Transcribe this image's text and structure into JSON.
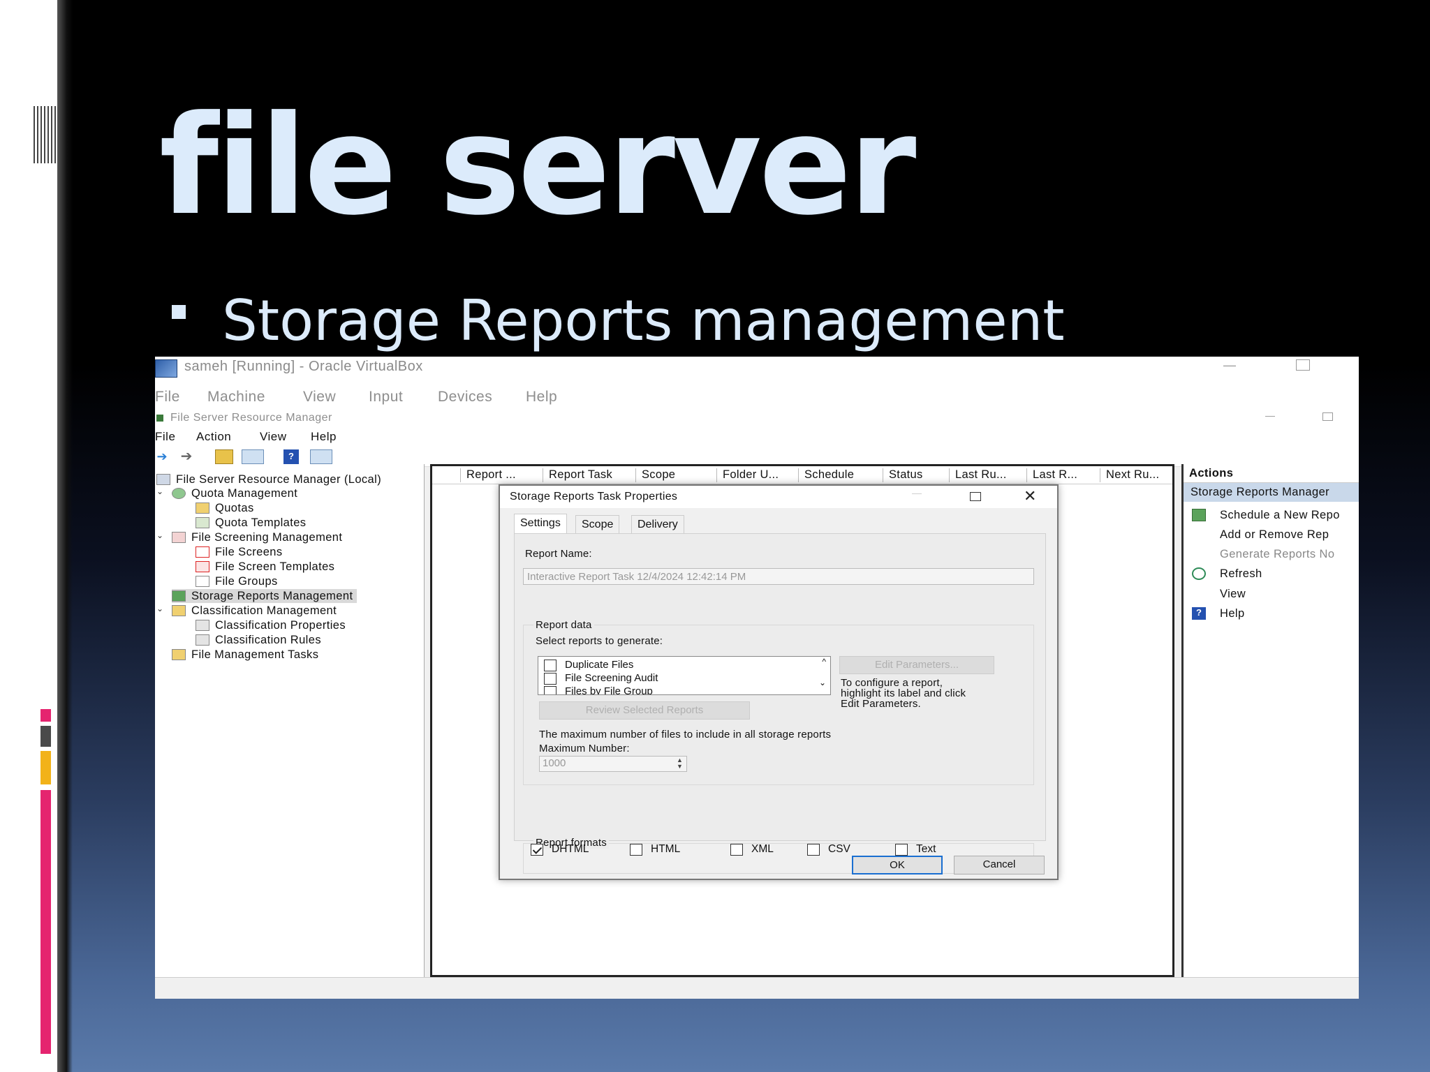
{
  "slide": {
    "title": "file server",
    "bullet": "Storage Reports management",
    "accent_colors": [
      "#e5246f",
      "#4a4a4a",
      "#f2b219",
      "#e5246f"
    ]
  },
  "virtualbox": {
    "title": "sameh [Running] - Oracle VirtualBox",
    "menu": [
      "File",
      "Machine",
      "View",
      "Input",
      "Devices",
      "Help"
    ]
  },
  "fsrm": {
    "title": "File Server Resource Manager",
    "menu": [
      "File",
      "Action",
      "View",
      "Help"
    ],
    "tree": [
      {
        "label": "File Server Resource Manager (Local)",
        "icon": "server-icon"
      },
      {
        "label": "Quota Management",
        "icon": "quota-icon"
      },
      {
        "label": "Quotas",
        "icon": "folder-icon"
      },
      {
        "label": "Quota Templates",
        "icon": "template-icon"
      },
      {
        "label": "File Screening Management",
        "icon": "screen-icon"
      },
      {
        "label": "File Screens",
        "icon": "file-screen-icon"
      },
      {
        "label": "File Screen Templates",
        "icon": "file-screen-template-icon"
      },
      {
        "label": "File Groups",
        "icon": "file-group-icon"
      },
      {
        "label": "Storage Reports Management",
        "icon": "reports-icon"
      },
      {
        "label": "Classification Management",
        "icon": "classification-icon"
      },
      {
        "label": "Classification Properties",
        "icon": "properties-icon"
      },
      {
        "label": "Classification Rules",
        "icon": "rules-icon"
      },
      {
        "label": "File Management Tasks",
        "icon": "folder-icon"
      }
    ],
    "columns": [
      "Report ...",
      "Report Task",
      "Scope",
      "Folder U...",
      "Schedule",
      "Status",
      "Last Ru...",
      "Last R...",
      "Next Ru..."
    ],
    "actions": {
      "header": "Actions",
      "section": "Storage Reports Manager",
      "items": [
        {
          "label": "Schedule a New Repo",
          "icon": "schedule-icon",
          "enabled": true
        },
        {
          "label": "Add or Remove Rep",
          "icon": "",
          "enabled": true
        },
        {
          "label": "Generate Reports No",
          "icon": "",
          "enabled": false
        },
        {
          "label": "Refresh",
          "icon": "refresh-icon",
          "enabled": true
        },
        {
          "label": "View",
          "icon": "",
          "enabled": true
        },
        {
          "label": "Help",
          "icon": "help-icon",
          "enabled": true
        }
      ]
    }
  },
  "dialog": {
    "title": "Storage Reports Task Properties",
    "tabs": [
      "Settings",
      "Scope",
      "Delivery"
    ],
    "report_name_label": "Report Name:",
    "report_name_value": "Interactive Report Task 12/4/2024 12:42:14 PM",
    "report_data_label": "Report data",
    "select_label": "Select reports to generate:",
    "reports": [
      {
        "label": "Duplicate Files",
        "checked": false
      },
      {
        "label": "File Screening Audit",
        "checked": false
      },
      {
        "label": "Files by File Group",
        "checked": false
      }
    ],
    "edit_params_button": "Edit Parameters...",
    "configure_hint": "To configure a report, highlight its label and click Edit Parameters.",
    "review_button": "Review Selected Reports",
    "max_files_text": "The maximum number of files to include in all storage reports",
    "max_number_label": "Maximum Number:",
    "max_number_value": "1000",
    "formats_label": "Report formats",
    "formats": [
      {
        "label": "DHTML",
        "checked": true
      },
      {
        "label": "HTML",
        "checked": false
      },
      {
        "label": "XML",
        "checked": false
      },
      {
        "label": "CSV",
        "checked": false
      },
      {
        "label": "Text",
        "checked": false
      }
    ],
    "ok_button": "OK",
    "cancel_button": "Cancel"
  }
}
